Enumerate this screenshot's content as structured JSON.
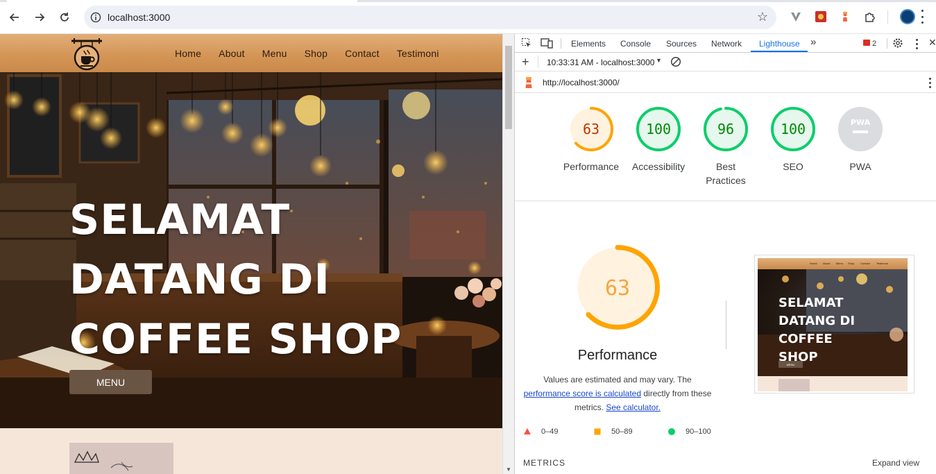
{
  "browser": {
    "url": "localhost:3000",
    "icons": [
      "back-arrow-icon",
      "forward-arrow-icon",
      "reload-icon",
      "site-info-icon",
      "bookmark-star-icon",
      "extension-icons",
      "puzzle-extensions-icon",
      "profile-avatar",
      "menu-kebab-icon"
    ]
  },
  "site": {
    "nav": [
      "Home",
      "About",
      "Menu",
      "Shop",
      "Contact",
      "Testimoni"
    ],
    "hero_title": "SELAMAT DATANG DI COFFEE SHOP",
    "hero_button": "MENU",
    "colors": {
      "nav": "#d39454",
      "button": "#6a5444",
      "page_bg": "#f6e6da"
    }
  },
  "devtools": {
    "tabs": [
      "Elements",
      "Console",
      "Sources",
      "Network",
      "Lighthouse"
    ],
    "active_tab": "Lighthouse",
    "issues_count": "2",
    "report_select": "10:33:31 AM - localhost:3000",
    "report_url": "http://localhost:3000/",
    "gauges": [
      {
        "label": "Performance",
        "score": "63",
        "value": 63,
        "color": "#ffa400"
      },
      {
        "label": "Accessibility",
        "score": "100",
        "value": 100,
        "color": "#0cce6b"
      },
      {
        "label": "Best Practices",
        "score": "96",
        "value": 96,
        "color": "#0cce6b"
      },
      {
        "label": "SEO",
        "score": "100",
        "value": 100,
        "color": "#0cce6b"
      },
      {
        "label": "PWA",
        "score": "",
        "value": 0,
        "color": "#cccccc"
      }
    ],
    "performance": {
      "score": "63",
      "value": 63,
      "title": "Performance",
      "desc_1": "Values are estimated and may vary. The",
      "desc_link": "performance score is calculated",
      "desc_2": "directly from these metrics.",
      "calc_link": "See calculator."
    },
    "thumbnail": {
      "nav": [
        "Home",
        "About",
        "Menu",
        "Shop",
        "Contact",
        "Testimoni"
      ],
      "title": "SELAMAT DATANG DI COFFEE SHOP",
      "button": "MENU"
    },
    "legend": [
      {
        "range": "0–49",
        "color": "#ff4e42",
        "shape": "triangle"
      },
      {
        "range": "50–89",
        "color": "#ffa400",
        "shape": "square"
      },
      {
        "range": "90–100",
        "color": "#0cce6b",
        "shape": "circle"
      }
    ],
    "metrics_heading": "METRICS",
    "expand_view": "Expand view"
  }
}
